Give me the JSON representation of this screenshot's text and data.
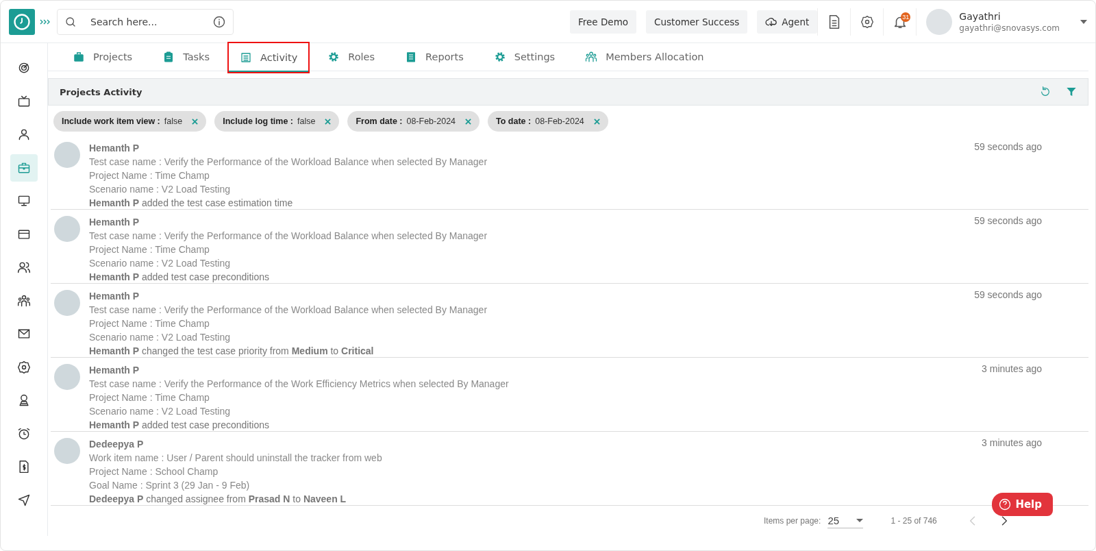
{
  "header": {
    "search": {
      "placeholder": "Search here..."
    },
    "buttons": [
      {
        "label": "Free Demo",
        "kind": "plain"
      },
      {
        "label": "Customer Success",
        "kind": "plain"
      },
      {
        "label": "Agent",
        "kind": "cloud"
      }
    ],
    "notifications": {
      "count": "31"
    },
    "user": {
      "name": "Gayathri",
      "email": "gayathri@snovasys.com"
    }
  },
  "sidebar": {
    "items": [
      {
        "kind": "target",
        "selected": false
      },
      {
        "kind": "tv",
        "selected": false
      },
      {
        "kind": "user",
        "selected": false
      },
      {
        "kind": "briefcase",
        "selected": true
      },
      {
        "kind": "monitor",
        "selected": false
      },
      {
        "kind": "card",
        "selected": false
      },
      {
        "kind": "users",
        "selected": false
      },
      {
        "kind": "team",
        "selected": false
      },
      {
        "kind": "mail",
        "selected": false
      },
      {
        "kind": "gear",
        "selected": false
      },
      {
        "kind": "badge",
        "selected": false
      },
      {
        "kind": "alarm",
        "selected": false
      },
      {
        "kind": "invoice",
        "selected": false
      },
      {
        "kind": "send",
        "selected": false
      }
    ]
  },
  "tabs": [
    {
      "label": "Projects",
      "kind": "briefcase",
      "selected": false,
      "highlighted": false
    },
    {
      "label": "Tasks",
      "kind": "clipboard",
      "selected": false,
      "highlighted": false
    },
    {
      "label": "Activity",
      "kind": "list",
      "selected": true,
      "highlighted": true
    },
    {
      "label": "Roles",
      "kind": "cog",
      "selected": false,
      "highlighted": false
    },
    {
      "label": "Reports",
      "kind": "report",
      "selected": false,
      "highlighted": false
    },
    {
      "label": "Settings",
      "kind": "cog",
      "selected": false,
      "highlighted": false
    },
    {
      "label": "Members Allocation",
      "kind": "team",
      "selected": false,
      "highlighted": false
    }
  ],
  "panel": {
    "title": "Projects Activity",
    "filters": [
      {
        "label": "Include work item view :",
        "value": "false"
      },
      {
        "label": "Include log time :",
        "value": "false"
      },
      {
        "label": "From date :",
        "value": "08-Feb-2024"
      },
      {
        "label": "To date :",
        "value": "08-Feb-2024"
      }
    ],
    "activities": [
      {
        "name": "Hemanth P",
        "time": "59 seconds ago",
        "lines": [
          "Test case name : Verify the Performance of the Workload Balance when selected By Manager",
          "Project Name : Time Champ",
          "Scenario name : V2 Load Testing"
        ],
        "action": "**Hemanth P**  added the test case estimation time"
      },
      {
        "name": "Hemanth P",
        "time": "59 seconds ago",
        "lines": [
          "Test case name : Verify the Performance of the Workload Balance when selected By Manager",
          "Project Name : Time Champ",
          "Scenario name : V2 Load Testing"
        ],
        "action": "**Hemanth P**  added test case preconditions"
      },
      {
        "name": "Hemanth P",
        "time": "59 seconds ago",
        "lines": [
          "Test case name : Verify the Performance of the Workload Balance when selected By Manager",
          "Project Name : Time Champ",
          "Scenario name : V2 Load Testing"
        ],
        "action": "**Hemanth P** changed the test case priority from  **Medium** to  **Critical**"
      },
      {
        "name": "Hemanth P",
        "time": "3 minutes ago",
        "lines": [
          "Test case name : Verify the Performance of the Work Efficiency Metrics when selected By Manager",
          "Project Name : Time Champ",
          "Scenario name : V2 Load Testing"
        ],
        "action": "**Hemanth P**  added test case preconditions"
      },
      {
        "name": "Dedeepya P",
        "time": "3 minutes ago",
        "lines": [
          "Work item name : User / Parent should uninstall the tracker from web",
          "Project Name : School Champ",
          "Goal Name : Sprint 3 (29 Jan - 9 Feb)"
        ],
        "action": "**Dedeepya P** changed assignee from  **Prasad N** to  **Naveen L**"
      }
    ]
  },
  "pagination": {
    "label": "Items per page:",
    "page_size": "25",
    "range": "1 - 25 of 746",
    "prev_disabled": true,
    "next_disabled": false
  },
  "help": {
    "label": "Help"
  }
}
